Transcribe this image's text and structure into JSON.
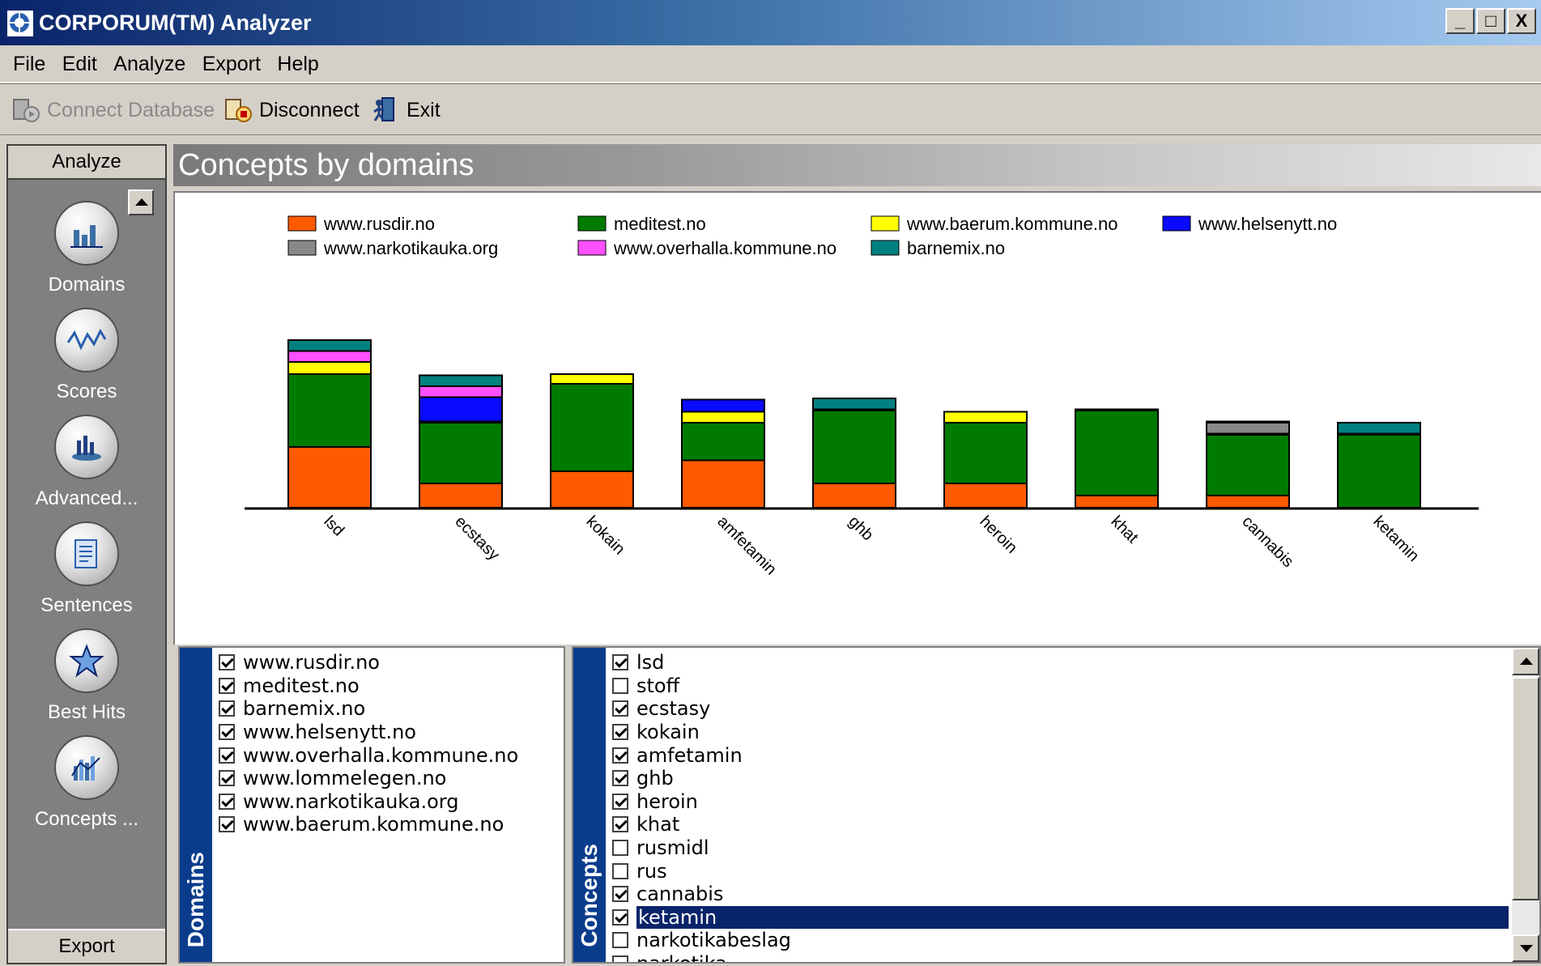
{
  "window": {
    "title": "CORPORUM(TM) Analyzer",
    "controls": [
      "_",
      "□",
      "X"
    ]
  },
  "menu": [
    "File",
    "Edit",
    "Analyze",
    "Export",
    "Help"
  ],
  "toolbar": {
    "connect": "Connect Database",
    "disconnect": "Disconnect",
    "exit": "Exit"
  },
  "sidebar": {
    "header": "Analyze",
    "footer": "Export",
    "items": [
      {
        "label": "Domains",
        "icon": "domains-chart-icon"
      },
      {
        "label": "Scores",
        "icon": "scores-wave-icon"
      },
      {
        "label": "Advanced...",
        "icon": "advanced-chart-icon"
      },
      {
        "label": "Sentences",
        "icon": "sentences-document-icon"
      },
      {
        "label": "Best Hits",
        "icon": "best-hits-star-icon"
      },
      {
        "label": "Concepts ...",
        "icon": "concepts-chart-icon"
      }
    ]
  },
  "panel": {
    "title": "Concepts by domains"
  },
  "chart_data": {
    "type": "bar",
    "stacked": true,
    "categories": [
      "lsd",
      "ecstasy",
      "kokain",
      "amfetamin",
      "ghb",
      "heroin",
      "khat",
      "cannabis",
      "ketamin"
    ],
    "series": [
      {
        "name": "www.rusdir.no",
        "color": "#ff5a00",
        "values": [
          50,
          20,
          30,
          39,
          20,
          20,
          10,
          10,
          0
        ]
      },
      {
        "name": "meditest.no",
        "color": "#007a00",
        "values": [
          60,
          50,
          72,
          31,
          60,
          50,
          70,
          50,
          60
        ]
      },
      {
        "name": "www.baerum.kommune.no",
        "color": "#ffff00",
        "values": [
          10,
          1,
          8,
          9,
          0,
          9,
          0,
          0,
          0
        ]
      },
      {
        "name": "www.helsenytt.no",
        "color": "#0a0aff",
        "values": [
          0,
          20,
          0,
          10,
          0,
          0,
          0,
          1,
          0
        ]
      },
      {
        "name": "www.narkotikauka.org",
        "color": "#888888",
        "values": [
          0,
          0,
          0,
          0,
          0,
          0,
          0,
          9,
          0
        ]
      },
      {
        "name": "www.overhalla.kommune.no",
        "color": "#ff50ff",
        "values": [
          9,
          9,
          0,
          0,
          1,
          0,
          0,
          0,
          1
        ]
      },
      {
        "name": "barnemix.no",
        "color": "#008080",
        "values": [
          9,
          9,
          0,
          0,
          9,
          0,
          1,
          1,
          9
        ]
      }
    ],
    "legend_position": "top",
    "grid": false
  },
  "domains_list": {
    "tab_label": "Domains",
    "items": [
      {
        "label": "www.rusdir.no",
        "checked": true
      },
      {
        "label": "meditest.no",
        "checked": true
      },
      {
        "label": "barnemix.no",
        "checked": true
      },
      {
        "label": "www.helsenytt.no",
        "checked": true
      },
      {
        "label": "www.overhalla.kommune.no",
        "checked": true
      },
      {
        "label": "www.lommelegen.no",
        "checked": true
      },
      {
        "label": "www.narkotikauka.org",
        "checked": true
      },
      {
        "label": "www.baerum.kommune.no",
        "checked": true
      }
    ]
  },
  "concepts_list": {
    "tab_label": "Concepts",
    "items": [
      {
        "label": "lsd",
        "checked": true
      },
      {
        "label": "stoff",
        "checked": false
      },
      {
        "label": "ecstasy",
        "checked": true
      },
      {
        "label": "kokain",
        "checked": true
      },
      {
        "label": "amfetamin",
        "checked": true
      },
      {
        "label": "ghb",
        "checked": true
      },
      {
        "label": "heroin",
        "checked": true
      },
      {
        "label": "khat",
        "checked": true
      },
      {
        "label": "rusmidl",
        "checked": false
      },
      {
        "label": "rus",
        "checked": false
      },
      {
        "label": "cannabis",
        "checked": true
      },
      {
        "label": "ketamin",
        "checked": true,
        "selected": true
      },
      {
        "label": "narkotikabeslag",
        "checked": false
      },
      {
        "label": "narkotika",
        "checked": false
      }
    ]
  }
}
